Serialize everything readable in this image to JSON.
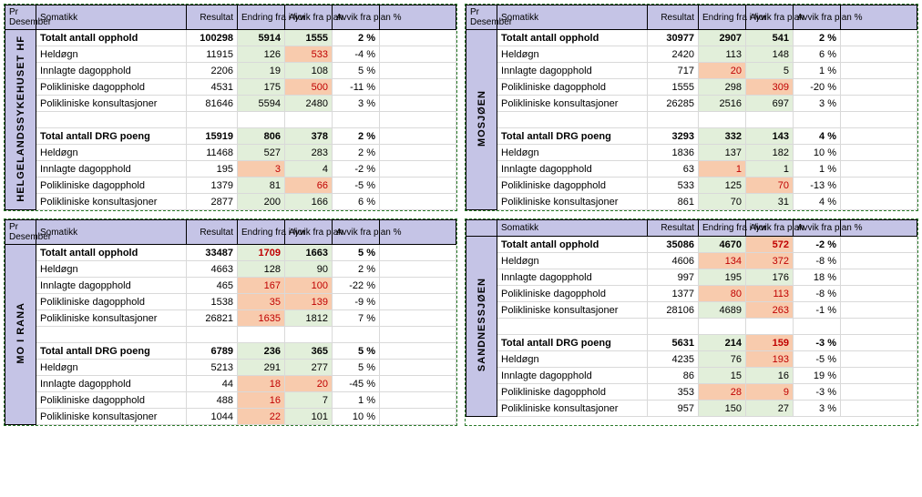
{
  "headers": {
    "period": "Pr Desember",
    "cat": "Somatikk",
    "res": "Resultat",
    "chg": "Endring fra i fjor",
    "dev": "Avvik fra plan",
    "devp": "Avvik fra plan %"
  },
  "rowlabels": {
    "tot_opp": "Totalt antall opphold",
    "heldogn": "Heldøgn",
    "innlagte": "Innlagte dagopphold",
    "polidag": "Polikliniske dagopphold",
    "polikon": "Polikliniske konsultasjoner",
    "tot_drg": "Total antall DRG poeng"
  },
  "panels": [
    {
      "id": "helg",
      "show_period": true,
      "unit": "HELGELANDSSYKEHUSET HF",
      "rows": [
        {
          "k": "tot_opp",
          "b": true,
          "v": [
            "100298",
            "5914",
            "1555",
            "2 %"
          ],
          "c": [
            "",
            "pos",
            "pos",
            ""
          ]
        },
        {
          "k": "heldogn",
          "v": [
            "11915",
            "126",
            "533",
            "-4 %"
          ],
          "c": [
            "",
            "pos",
            "neg",
            ""
          ]
        },
        {
          "k": "innlagte",
          "v": [
            "2206",
            "19",
            "108",
            "5 %"
          ],
          "c": [
            "",
            "pos",
            "pos",
            ""
          ]
        },
        {
          "k": "polidag",
          "v": [
            "4531",
            "175",
            "500",
            "-11 %"
          ],
          "c": [
            "",
            "pos",
            "neg",
            ""
          ]
        },
        {
          "k": "polikon",
          "v": [
            "81646",
            "5594",
            "2480",
            "3 %"
          ],
          "c": [
            "",
            "pos",
            "pos",
            ""
          ]
        },
        {
          "blank": true
        },
        {
          "k": "tot_drg",
          "b": true,
          "v": [
            "15919",
            "806",
            "378",
            "2 %"
          ],
          "c": [
            "",
            "pos",
            "pos",
            ""
          ]
        },
        {
          "k": "heldogn",
          "v": [
            "11468",
            "527",
            "283",
            "2 %"
          ],
          "c": [
            "",
            "pos",
            "pos",
            ""
          ]
        },
        {
          "k": "innlagte",
          "v": [
            "195",
            "3",
            "4",
            "-2 %"
          ],
          "c": [
            "",
            "neg",
            "pos",
            ""
          ]
        },
        {
          "k": "polidag",
          "v": [
            "1379",
            "81",
            "66",
            "-5 %"
          ],
          "c": [
            "",
            "pos",
            "neg",
            ""
          ]
        },
        {
          "k": "polikon",
          "v": [
            "2877",
            "200",
            "166",
            "6 %"
          ],
          "c": [
            "",
            "pos",
            "pos",
            ""
          ]
        }
      ]
    },
    {
      "id": "mosj",
      "show_period": true,
      "unit": "MOSJØEN",
      "rows": [
        {
          "k": "tot_opp",
          "b": true,
          "v": [
            "30977",
            "2907",
            "541",
            "2 %"
          ],
          "c": [
            "",
            "pos",
            "pos",
            ""
          ]
        },
        {
          "k": "heldogn",
          "v": [
            "2420",
            "113",
            "148",
            "6 %"
          ],
          "c": [
            "",
            "pos",
            "pos",
            ""
          ]
        },
        {
          "k": "innlagte",
          "v": [
            "717",
            "20",
            "5",
            "1 %"
          ],
          "c": [
            "",
            "neg",
            "pos",
            ""
          ]
        },
        {
          "k": "polidag",
          "v": [
            "1555",
            "298",
            "309",
            "-20 %"
          ],
          "c": [
            "",
            "pos",
            "neg",
            ""
          ]
        },
        {
          "k": "polikon",
          "v": [
            "26285",
            "2516",
            "697",
            "3 %"
          ],
          "c": [
            "",
            "pos",
            "pos",
            ""
          ]
        },
        {
          "blank": true
        },
        {
          "k": "tot_drg",
          "b": true,
          "v": [
            "3293",
            "332",
            "143",
            "4 %"
          ],
          "c": [
            "",
            "pos",
            "pos",
            ""
          ]
        },
        {
          "k": "heldogn",
          "v": [
            "1836",
            "137",
            "182",
            "10 %"
          ],
          "c": [
            "",
            "pos",
            "pos",
            ""
          ]
        },
        {
          "k": "innlagte",
          "v": [
            "63",
            "1",
            "1",
            "1 %"
          ],
          "c": [
            "",
            "neg",
            "pos",
            ""
          ]
        },
        {
          "k": "polidag",
          "v": [
            "533",
            "125",
            "70",
            "-13 %"
          ],
          "c": [
            "",
            "pos",
            "neg",
            ""
          ]
        },
        {
          "k": "polikon",
          "v": [
            "861",
            "70",
            "31",
            "4 %"
          ],
          "c": [
            "",
            "pos",
            "pos",
            ""
          ]
        }
      ]
    },
    {
      "id": "rana",
      "show_period": true,
      "unit": "MO I RANA",
      "rows": [
        {
          "k": "tot_opp",
          "b": true,
          "v": [
            "33487",
            "1709",
            "1663",
            "5 %"
          ],
          "c": [
            "",
            "negc pos",
            "pos",
            ""
          ]
        },
        {
          "k": "heldogn",
          "v": [
            "4663",
            "128",
            "90",
            "2 %"
          ],
          "c": [
            "",
            "pos",
            "pos",
            ""
          ]
        },
        {
          "k": "innlagte",
          "v": [
            "465",
            "167",
            "100",
            "-22 %"
          ],
          "c": [
            "",
            "neg",
            "neg",
            ""
          ]
        },
        {
          "k": "polidag",
          "v": [
            "1538",
            "35",
            "139",
            "-9 %"
          ],
          "c": [
            "",
            "neg",
            "neg",
            ""
          ]
        },
        {
          "k": "polikon",
          "v": [
            "26821",
            "1635",
            "1812",
            "7 %"
          ],
          "c": [
            "",
            "neg",
            "pos",
            ""
          ]
        },
        {
          "blank": true
        },
        {
          "k": "tot_drg",
          "b": true,
          "v": [
            "6789",
            "236",
            "365",
            "5 %"
          ],
          "c": [
            "",
            "pos",
            "pos",
            ""
          ]
        },
        {
          "k": "heldogn",
          "v": [
            "5213",
            "291",
            "277",
            "5 %"
          ],
          "c": [
            "",
            "pos",
            "pos",
            ""
          ]
        },
        {
          "k": "innlagte",
          "v": [
            "44",
            "18",
            "20",
            "-45 %"
          ],
          "c": [
            "",
            "neg",
            "neg",
            ""
          ]
        },
        {
          "k": "polidag",
          "v": [
            "488",
            "16",
            "7",
            "1 %"
          ],
          "c": [
            "",
            "neg",
            "pos",
            ""
          ]
        },
        {
          "k": "polikon",
          "v": [
            "1044",
            "22",
            "101",
            "10 %"
          ],
          "c": [
            "",
            "neg",
            "pos",
            ""
          ]
        }
      ]
    },
    {
      "id": "sand",
      "show_period": false,
      "unit": "SANDNESSJØEN",
      "rows": [
        {
          "k": "tot_opp",
          "b": true,
          "v": [
            "35086",
            "4670",
            "572",
            "-2 %"
          ],
          "c": [
            "",
            "pos",
            "neg",
            ""
          ]
        },
        {
          "k": "heldogn",
          "v": [
            "4606",
            "134",
            "372",
            "-8 %"
          ],
          "c": [
            "",
            "neg",
            "neg",
            ""
          ]
        },
        {
          "k": "innlagte",
          "v": [
            "997",
            "195",
            "176",
            "18 %"
          ],
          "c": [
            "",
            "pos",
            "pos",
            ""
          ]
        },
        {
          "k": "polidag",
          "v": [
            "1377",
            "80",
            "113",
            "-8 %"
          ],
          "c": [
            "",
            "neg",
            "neg",
            ""
          ]
        },
        {
          "k": "polikon",
          "v": [
            "28106",
            "4689",
            "263",
            "-1 %"
          ],
          "c": [
            "",
            "pos",
            "neg",
            ""
          ]
        },
        {
          "blank": true
        },
        {
          "k": "tot_drg",
          "b": true,
          "v": [
            "5631",
            "214",
            "159",
            "-3 %"
          ],
          "c": [
            "",
            "pos",
            "neg",
            ""
          ]
        },
        {
          "k": "heldogn",
          "v": [
            "4235",
            "76",
            "193",
            "-5 %"
          ],
          "c": [
            "",
            "pos",
            "neg",
            ""
          ]
        },
        {
          "k": "innlagte",
          "v": [
            "86",
            "15",
            "16",
            "19 %"
          ],
          "c": [
            "",
            "pos",
            "pos",
            ""
          ]
        },
        {
          "k": "polidag",
          "v": [
            "353",
            "28",
            "9",
            "-3 %"
          ],
          "c": [
            "",
            "neg",
            "neg",
            ""
          ]
        },
        {
          "k": "polikon",
          "v": [
            "957",
            "150",
            "27",
            "3 %"
          ],
          "c": [
            "",
            "pos",
            "pos",
            ""
          ]
        }
      ]
    }
  ]
}
